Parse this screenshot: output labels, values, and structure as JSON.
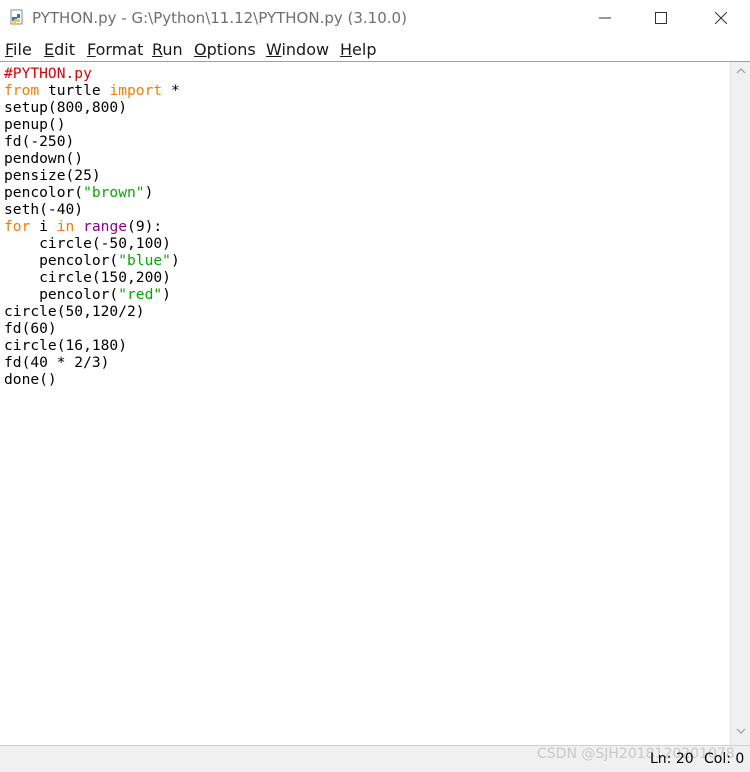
{
  "window": {
    "title": "PYTHON.py - G:\\Python\\11.12\\PYTHON.py (3.10.0)",
    "icon": "python-file-icon"
  },
  "menu": [
    {
      "ul": "F",
      "rest": "ile"
    },
    {
      "ul": "E",
      "rest": "dit"
    },
    {
      "ul": "F",
      "rest": "ormat",
      "pre": ""
    },
    {
      "ul": "R",
      "rest": "un"
    },
    {
      "ul": "O",
      "rest": "ptions"
    },
    {
      "ul": "W",
      "rest": "indow"
    },
    {
      "ul": "H",
      "rest": "elp"
    }
  ],
  "code": [
    [
      {
        "t": "#PYTHON.py",
        "c": "comment"
      }
    ],
    [
      {
        "t": "from",
        "c": "keyword"
      },
      {
        "t": " turtle "
      },
      {
        "t": "import",
        "c": "keyword"
      },
      {
        "t": " *"
      }
    ],
    [
      {
        "t": "setup(800,800)"
      }
    ],
    [
      {
        "t": "penup()"
      }
    ],
    [
      {
        "t": "fd(-250)"
      }
    ],
    [
      {
        "t": "pendown()"
      }
    ],
    [
      {
        "t": "pensize(25)"
      }
    ],
    [
      {
        "t": "pencolor("
      },
      {
        "t": "\"brown\"",
        "c": "string"
      },
      {
        "t": ")"
      }
    ],
    [
      {
        "t": "seth(-40)"
      }
    ],
    [
      {
        "t": "for",
        "c": "keyword"
      },
      {
        "t": " i "
      },
      {
        "t": "in",
        "c": "keyword"
      },
      {
        "t": " "
      },
      {
        "t": "range",
        "c": "builtin"
      },
      {
        "t": "(9):"
      }
    ],
    [
      {
        "t": "    circle(-50,100)"
      }
    ],
    [
      {
        "t": "    pencolor("
      },
      {
        "t": "\"blue\"",
        "c": "string"
      },
      {
        "t": ")"
      }
    ],
    [
      {
        "t": "    circle(150,200)"
      }
    ],
    [
      {
        "t": "    pencolor("
      },
      {
        "t": "\"red\"",
        "c": "string"
      },
      {
        "t": ")"
      }
    ],
    [
      {
        "t": "circle(50,120/2)"
      }
    ],
    [
      {
        "t": "fd(60)"
      }
    ],
    [
      {
        "t": "circle(16,180)"
      }
    ],
    [
      {
        "t": "fd(40 * 2/3)"
      }
    ],
    [
      {
        "t": "done()"
      }
    ]
  ],
  "status": {
    "ln": "Ln: 20",
    "col": "Col: 0",
    "watermark": "CSDN @SJH2018120201078"
  },
  "colors": {
    "comment": "#dd0000",
    "keyword": "#ff7700",
    "builtin": "#900090",
    "string": "#00aa00"
  }
}
